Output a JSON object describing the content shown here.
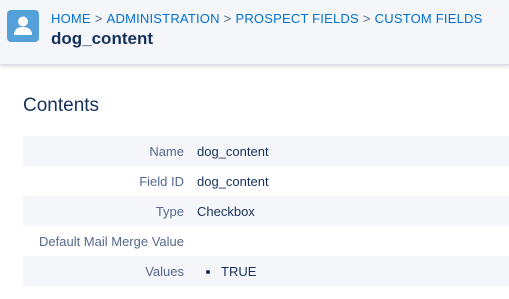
{
  "header": {
    "breadcrumb": [
      "HOME",
      "ADMINISTRATION",
      "PROSPECT FIELDS",
      "CUSTOM FIELDS"
    ],
    "separator": ">",
    "title": "dog_content",
    "icon": "user-icon"
  },
  "main": {
    "section_title": "Contents",
    "rows": [
      {
        "label": "Name",
        "value": "dog_content"
      },
      {
        "label": "Field ID",
        "value": "dog_content"
      },
      {
        "label": "Type",
        "value": "Checkbox"
      },
      {
        "label": "Default Mail Merge Value",
        "value": ""
      },
      {
        "label": "Values",
        "items": [
          "TRUE"
        ]
      }
    ]
  },
  "colors": {
    "accent": "#0070d2",
    "icon_bg": "#54a0d8",
    "header_bg": "#f4f6f9",
    "row_shade": "#f4f6f9"
  }
}
